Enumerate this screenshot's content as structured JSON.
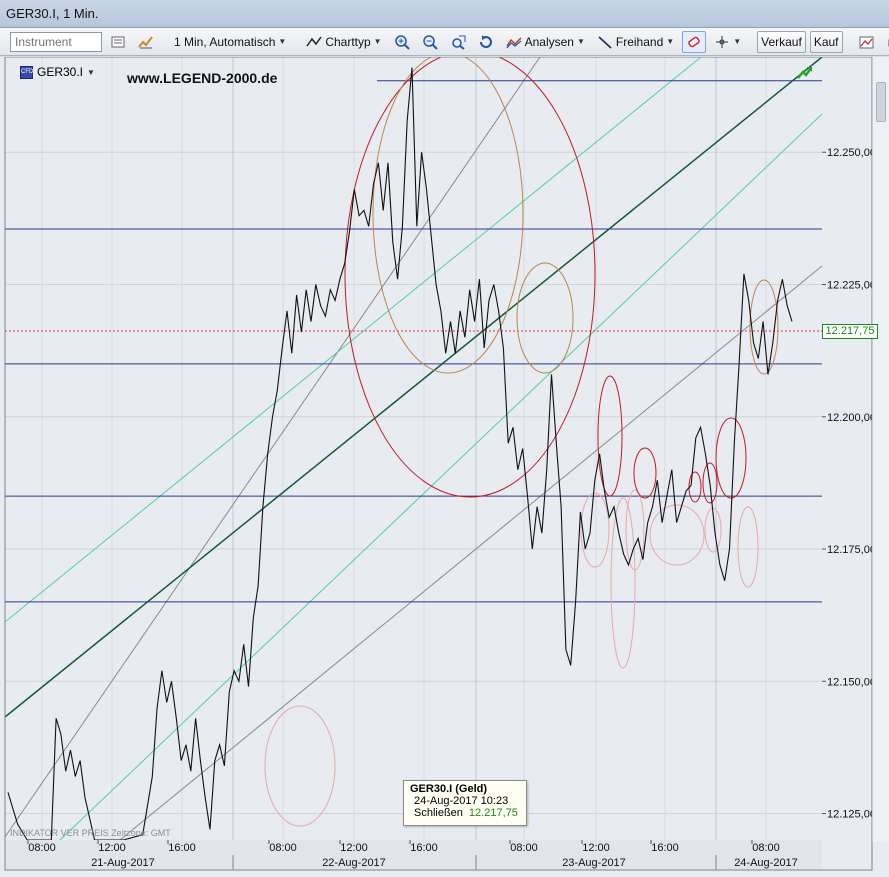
{
  "window": {
    "title": "GER30.I, 1 Min."
  },
  "toolbar": {
    "instrument_placeholder": "Instrument",
    "interval_label": "1 Min,  Automatisch",
    "charttype_label": "Charttyp",
    "analysen_label": "Analysen",
    "freihand_label": "Freihand",
    "verkauf_label": "Verkauf",
    "kauf_label": "Kauf"
  },
  "chart": {
    "instrument": "GER30.I",
    "watermark": "www.LEGEND-2000.de",
    "last_price_label": "12.217,75",
    "indicator_note": "INDIKATOR VER PREIS   Zeitzone: GMT",
    "tooltip": {
      "title": "GER30.I (Geld)",
      "datetime": "24-Aug-2017 10:23",
      "close_label": "Schließen",
      "close_value": "12.217,75"
    }
  },
  "chart_data": {
    "type": "line",
    "series": [
      {
        "name": "GER30.I"
      }
    ],
    "y_ticks": [
      "12.250,00",
      "12.225,00",
      "12.200,00",
      "12.175,00",
      "12.150,00",
      "12.125,00"
    ],
    "ylim": [
      12120,
      12268
    ],
    "x_time_labels": [
      "08:00",
      "12:00",
      "16:00",
      "08:00",
      "12:00",
      "16:00",
      "08:00",
      "12:00",
      "16:00",
      "08:00"
    ],
    "x_date_labels": [
      "21-Aug-2017",
      "22-Aug-2017",
      "23-Aug-2017",
      "24-Aug-2017"
    ],
    "last_value": 12217.75,
    "horizontal_levels": [
      12263.5,
      12235.5,
      12210,
      12185,
      12165
    ],
    "price_path": [
      [
        0,
        12129
      ],
      [
        2,
        12123
      ],
      [
        4,
        12117
      ],
      [
        6,
        12112
      ],
      [
        7,
        12108
      ],
      [
        9,
        12119
      ],
      [
        10,
        12143
      ],
      [
        11,
        12140
      ],
      [
        12,
        12133
      ],
      [
        13,
        12137
      ],
      [
        14,
        12132
      ],
      [
        15,
        12135
      ],
      [
        16,
        12128
      ],
      [
        17,
        12124
      ],
      [
        18,
        12105
      ],
      [
        24,
        12112
      ],
      [
        28,
        12121
      ],
      [
        30,
        12132
      ],
      [
        31,
        12145
      ],
      [
        32,
        12152
      ],
      [
        33,
        12146
      ],
      [
        34,
        12150
      ],
      [
        35,
        12143
      ],
      [
        36,
        12135
      ],
      [
        37,
        12138
      ],
      [
        38,
        12133
      ],
      [
        39,
        12143
      ],
      [
        40,
        12135
      ],
      [
        41,
        12128
      ],
      [
        42,
        12122
      ],
      [
        43,
        12135
      ],
      [
        44,
        12138
      ],
      [
        45,
        12134
      ],
      [
        46,
        12148
      ],
      [
        47,
        12152
      ],
      [
        48,
        12150
      ],
      [
        49,
        12157
      ],
      [
        50,
        12149
      ],
      [
        51,
        12162
      ],
      [
        52,
        12168
      ],
      [
        53,
        12183
      ],
      [
        54,
        12193
      ],
      [
        55,
        12200
      ],
      [
        56,
        12205
      ],
      [
        57,
        12213
      ],
      [
        58,
        12220
      ],
      [
        59,
        12212
      ],
      [
        60,
        12223
      ],
      [
        61,
        12216
      ],
      [
        62,
        12224
      ],
      [
        63,
        12218
      ],
      [
        64,
        12225
      ],
      [
        65,
        12221
      ],
      [
        66,
        12219
      ],
      [
        67,
        12224
      ],
      [
        68,
        12222
      ],
      [
        69,
        12226
      ],
      [
        70,
        12229
      ],
      [
        71,
        12235
      ],
      [
        72,
        12243
      ],
      [
        73,
        12238
      ],
      [
        74,
        12239
      ],
      [
        75,
        12236
      ],
      [
        76,
        12244
      ],
      [
        77,
        12248
      ],
      [
        78,
        12239
      ],
      [
        79,
        12248
      ],
      [
        80,
        12233
      ],
      [
        81,
        12226
      ],
      [
        82,
        12236
      ],
      [
        83,
        12256
      ],
      [
        84,
        12266
      ],
      [
        85,
        12236
      ],
      [
        86,
        12250
      ],
      [
        87,
        12243
      ],
      [
        88,
        12234
      ],
      [
        89,
        12225
      ],
      [
        90,
        12220
      ],
      [
        91,
        12212
      ],
      [
        92,
        12218
      ],
      [
        93,
        12212
      ],
      [
        94,
        12220
      ],
      [
        95,
        12215
      ],
      [
        96,
        12224
      ],
      [
        97,
        12218
      ],
      [
        98,
        12226
      ],
      [
        99,
        12213
      ],
      [
        100,
        12222
      ],
      [
        101,
        12225
      ],
      [
        102,
        12220
      ],
      [
        103,
        12213
      ],
      [
        104,
        12195
      ],
      [
        105,
        12198
      ],
      [
        106,
        12190
      ],
      [
        107,
        12194
      ],
      [
        108,
        12185
      ],
      [
        109,
        12175
      ],
      [
        110,
        12183
      ],
      [
        111,
        12178
      ],
      [
        112,
        12190
      ],
      [
        113,
        12208
      ],
      [
        114,
        12195
      ],
      [
        115,
        12183
      ],
      [
        116,
        12156
      ],
      [
        117,
        12153
      ],
      [
        118,
        12165
      ],
      [
        119,
        12182
      ],
      [
        120,
        12175
      ],
      [
        121,
        12178
      ],
      [
        122,
        12188
      ],
      [
        123,
        12193
      ],
      [
        124,
        12186
      ],
      [
        125,
        12181
      ],
      [
        126,
        12183
      ],
      [
        127,
        12178
      ],
      [
        128,
        12174
      ],
      [
        129,
        12172
      ],
      [
        130,
        12175
      ],
      [
        131,
        12177
      ],
      [
        132,
        12173
      ],
      [
        133,
        12180
      ],
      [
        134,
        12183
      ],
      [
        135,
        12188
      ],
      [
        136,
        12180
      ],
      [
        137,
        12185
      ],
      [
        138,
        12190
      ],
      [
        139,
        12180
      ],
      [
        140,
        12183
      ],
      [
        141,
        12186
      ],
      [
        142,
        12187
      ],
      [
        143,
        12196
      ],
      [
        144,
        12198
      ],
      [
        145,
        12193
      ],
      [
        146,
        12187
      ],
      [
        147,
        12178
      ],
      [
        148,
        12172
      ],
      [
        149,
        12169
      ],
      [
        150,
        12175
      ],
      [
        151,
        12195
      ],
      [
        152,
        12210
      ],
      [
        153,
        12227
      ],
      [
        154,
        12222
      ],
      [
        155,
        12214
      ],
      [
        156,
        12211
      ],
      [
        157,
        12218
      ],
      [
        158,
        12208
      ],
      [
        159,
        12214
      ],
      [
        160,
        12222
      ],
      [
        161,
        12226
      ],
      [
        162,
        12221
      ],
      [
        163,
        12218
      ]
    ]
  }
}
